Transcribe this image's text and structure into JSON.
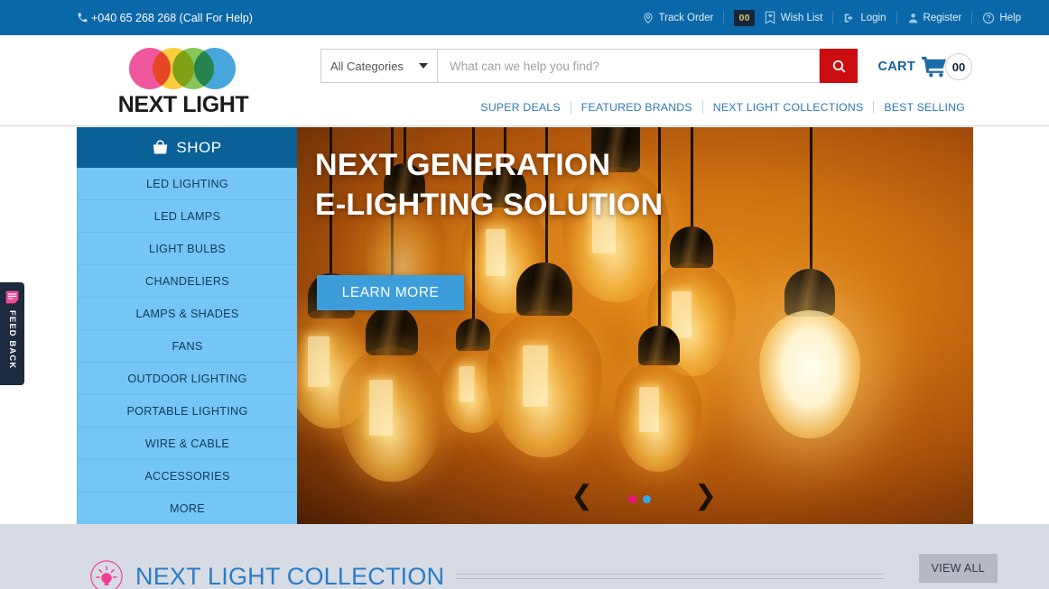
{
  "topbar": {
    "phone": "+040 65 268 268 (Call For Help)",
    "phone_icon": "phone-icon",
    "items": [
      {
        "label": "Track Order",
        "icon": "location-pin-icon"
      },
      {
        "label": "Wish List",
        "icon": "wishlist-heart-icon",
        "badge": "00"
      },
      {
        "label": "Login",
        "icon": "login-arrow-icon"
      },
      {
        "label": "Register",
        "icon": "user-icon"
      },
      {
        "label": "Help",
        "icon": "question-circle-icon"
      }
    ]
  },
  "header": {
    "logo_text": "NEXT LIGHT",
    "logo_colors": [
      "#ec3f8e",
      "#f7c623",
      "#74c043",
      "#2e9ad8"
    ],
    "search": {
      "category": "All Categories",
      "placeholder": "What can we help you find?",
      "button_icon": "search-icon",
      "button_color": "#cc0d10"
    },
    "cart": {
      "label": "CART",
      "count": "00",
      "icon": "shopping-cart-icon"
    },
    "nav": [
      "SUPER DEALS",
      "FEATURED BRANDS",
      "NEXT LIGHT COLLECTIONS",
      "BEST SELLING"
    ]
  },
  "sidebar": {
    "header": {
      "label": "SHOP",
      "icon": "shopping-bag-icon"
    },
    "items": [
      {
        "label": "LED LIGHTING"
      },
      {
        "label": "LED LAMPS"
      },
      {
        "label": "LIGHT BULBS"
      },
      {
        "label": "CHANDELIERS"
      },
      {
        "label": "LAMPS & SHADES"
      },
      {
        "label": "FANS"
      },
      {
        "label": "OUTDOOR LIGHTING"
      },
      {
        "label": "PORTABLE LIGHTING"
      },
      {
        "label": "WIRE & CABLE"
      },
      {
        "label": "ACCESSORIES"
      },
      {
        "label": "MORE"
      }
    ]
  },
  "hero": {
    "title_line1": "NEXT GENERATION",
    "title_line2": "E-LIGHTING SOLUTION",
    "cta": "LEARN MORE",
    "cta_color": "#3d9ddb",
    "prev_icon": "chevron-left-icon",
    "next_icon": "chevron-right-icon",
    "prev_glyph": "❮",
    "next_glyph": "❯",
    "dots": [
      {
        "active": true,
        "color": "#e8127c"
      },
      {
        "active": false,
        "color": "#34a9e8"
      }
    ]
  },
  "feedback": {
    "label": "FEED BACK",
    "icon": "feedback-note-icon"
  },
  "bottom": {
    "section_title": "NEXT LIGHT COLLECTION",
    "section_icon": "bulb-circle-icon",
    "view_all": "VIEW ALL"
  }
}
